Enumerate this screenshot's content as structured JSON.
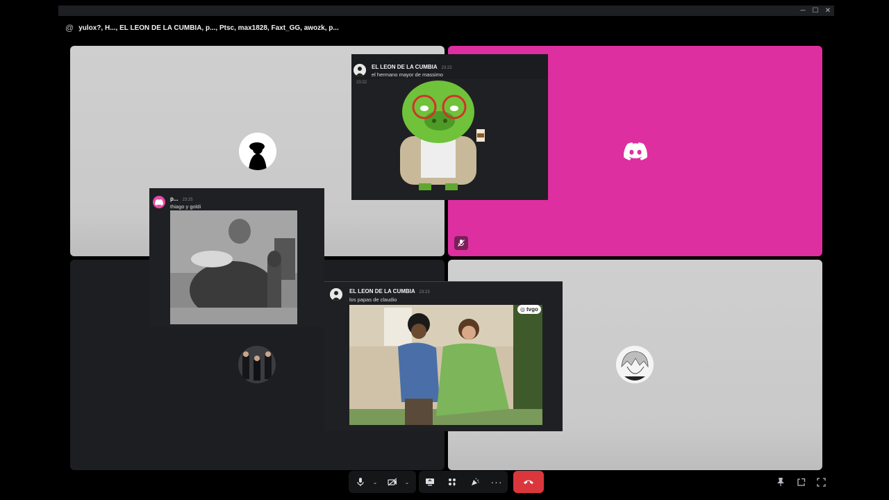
{
  "window": {
    "minimize_glyph": "─",
    "maximize_glyph": "☐",
    "close_glyph": "✕"
  },
  "header": {
    "at_glyph": "@",
    "title": "yulox?, H..., EL LEON DE LA CUMBIA, p..., Ptsc, max1828, Faxt_GG, awozk, p..."
  },
  "popups": {
    "pig": {
      "author": "EL LEON DE LA CUMBIA",
      "time": "23:22",
      "text": "el hermano mayor de massimo",
      "inline_time": "23:22"
    },
    "fat": {
      "author": "p...",
      "time": "23:25",
      "text": "thiago y goldi"
    },
    "couple": {
      "author": "EL LEON DE LA CUMBIA",
      "time": "23:23",
      "text": "los papas de claudio",
      "watermark": "tvgo"
    }
  },
  "controls": {
    "end_call_color": "#da373c",
    "icons": [
      "microphone-icon",
      "camera-off-icon",
      "screen-share-icon",
      "activities-icon",
      "soundboard-icon",
      "more-icon",
      "hang-up-icon",
      "pin-icon",
      "popout-icon",
      "fullscreen-icon"
    ]
  },
  "colors": {
    "pink_tile": "#dd2f9f",
    "gray_tile": "#cfcfcf",
    "dark_tile": "#1c1e21"
  }
}
